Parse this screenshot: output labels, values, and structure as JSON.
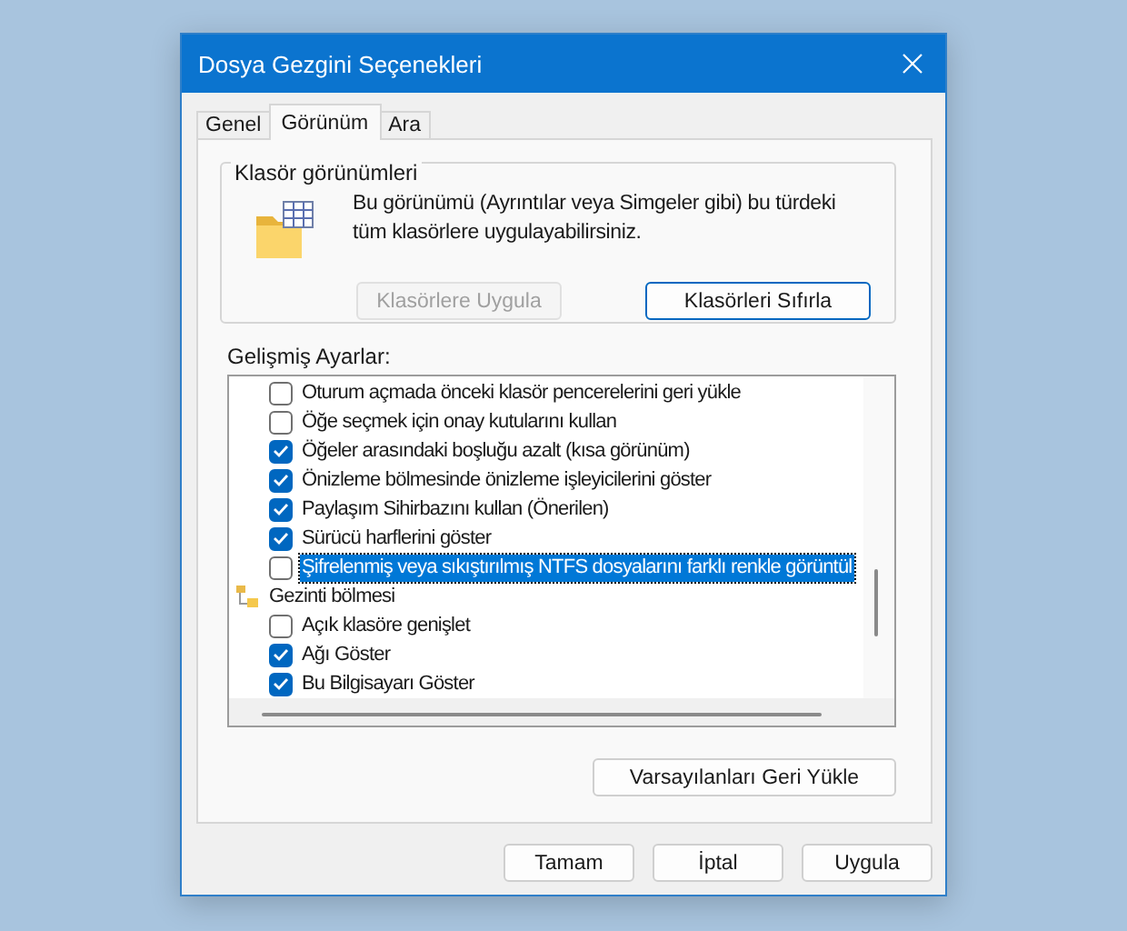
{
  "window": {
    "title": "Dosya Gezgini Seçenekleri"
  },
  "tabs": [
    {
      "label": "Genel",
      "selected": false
    },
    {
      "label": "Görünüm",
      "selected": true
    },
    {
      "label": "Ara",
      "selected": false
    }
  ],
  "folder_views": {
    "legend": "Klasör görünümleri",
    "description": "Bu görünümü (Ayrıntılar veya Simgeler gibi) bu türdeki tüm klasörlere uygulayabilirsiniz.",
    "buttons": [
      {
        "label": "Klasörlere Uygula",
        "disabled": true,
        "default": false
      },
      {
        "label": "Klasörleri Sıfırla",
        "disabled": false,
        "default": true
      }
    ]
  },
  "advanced": {
    "label": "Gelişmiş Ayarlar:",
    "items": [
      {
        "kind": "continued",
        "children": [
          {
            "kind": "checkbox",
            "label": "Oturum açmada önceki klasör pencerelerini geri yükle",
            "checked": false,
            "selected": false
          },
          {
            "kind": "checkbox",
            "label": "Öğe seçmek için onay kutularını kullan",
            "checked": false,
            "selected": false
          },
          {
            "kind": "checkbox",
            "label": "Öğeler arasındaki boşluğu azalt (kısa görünüm)",
            "checked": true,
            "selected": false
          },
          {
            "kind": "checkbox",
            "label": "Önizleme bölmesinde önizleme işleyicilerini göster",
            "checked": true,
            "selected": false
          },
          {
            "kind": "checkbox",
            "label": "Paylaşım Sihirbazını kullan (Önerilen)",
            "checked": true,
            "selected": false
          },
          {
            "kind": "checkbox",
            "label": "Sürücü harflerini göster",
            "checked": true,
            "selected": false
          },
          {
            "kind": "checkbox",
            "label": "Şifrelenmiş veya sıkıştırılmış NTFS dosyalarını farklı renkle görüntül",
            "checked": false,
            "selected": true
          }
        ]
      },
      {
        "kind": "folder",
        "label": "Gezinti bölmesi",
        "children": [
          {
            "kind": "checkbox",
            "label": "Açık klasöre genişlet",
            "checked": false,
            "selected": false
          },
          {
            "kind": "checkbox",
            "label": "Ağı Göster",
            "checked": true,
            "selected": false
          },
          {
            "kind": "checkbox",
            "label": "Bu Bilgisayarı Göster",
            "checked": true,
            "selected": false
          }
        ]
      }
    ]
  },
  "restore_button": "Varsayılanları Geri Yükle",
  "buttons": [
    {
      "label": "Tamam"
    },
    {
      "label": "İptal"
    },
    {
      "label": "Uygula"
    }
  ]
}
